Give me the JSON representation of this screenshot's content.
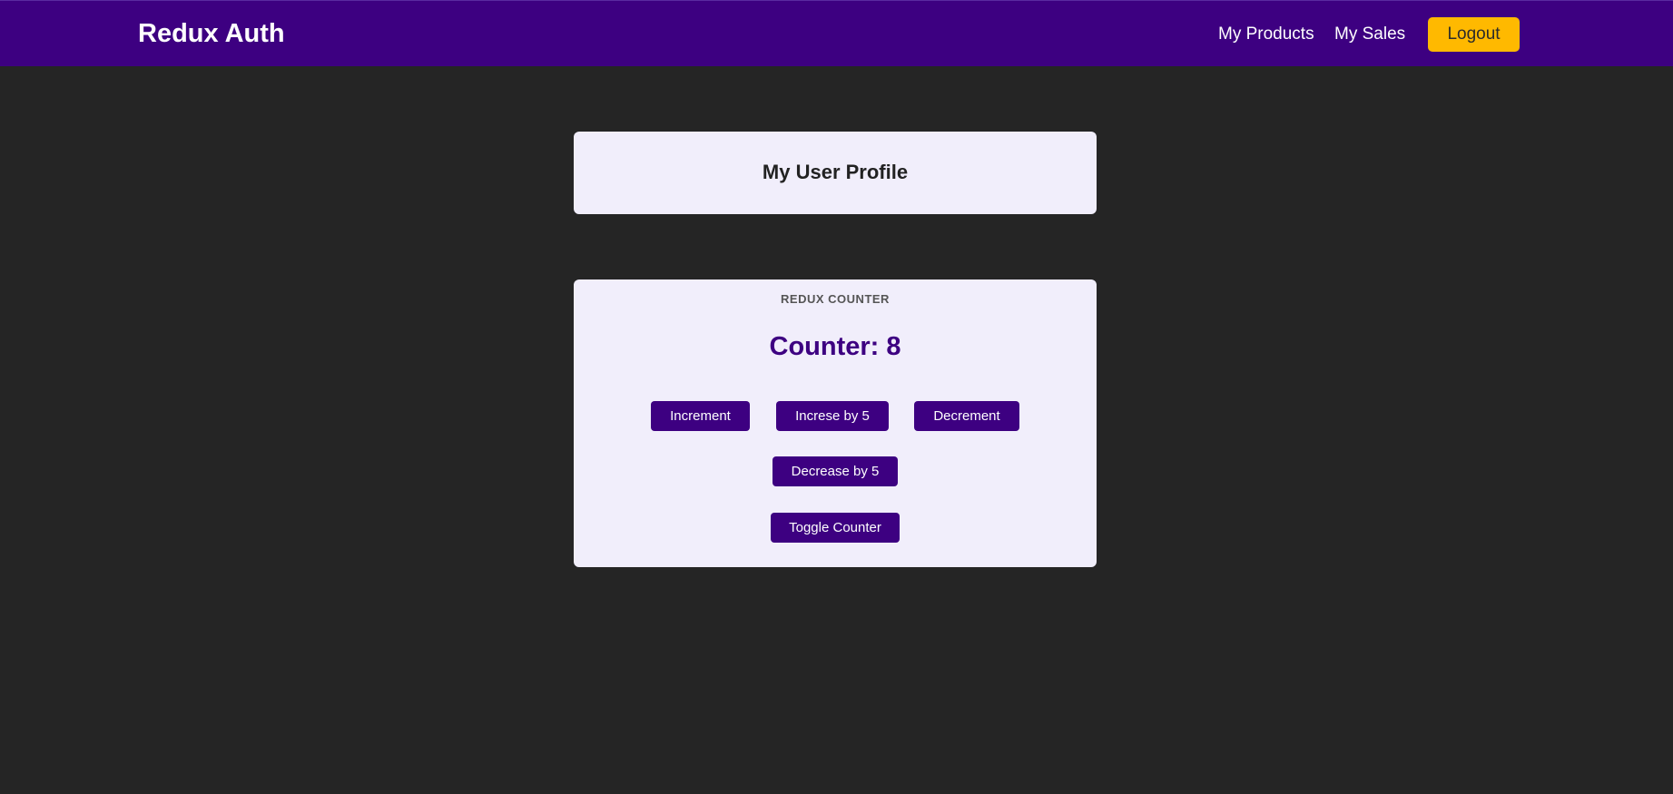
{
  "header": {
    "brand": "Redux Auth",
    "nav": {
      "products": "My Products",
      "sales": "My Sales"
    },
    "logout_label": "Logout"
  },
  "profile": {
    "title": "My User Profile"
  },
  "counter": {
    "label": "REDUX COUNTER",
    "value_text": "Counter: 8",
    "buttons": {
      "increment": "Increment",
      "increase_by_5": "Increse by 5",
      "decrement": "Decrement",
      "decrease_by_5": "Decrease by 5",
      "toggle": "Toggle Counter"
    }
  },
  "colors": {
    "header_bg": "#3d0081",
    "page_bg": "#252525",
    "card_bg": "#f1eefb",
    "accent_button": "#ffb900",
    "primary_button": "#3d0081"
  }
}
